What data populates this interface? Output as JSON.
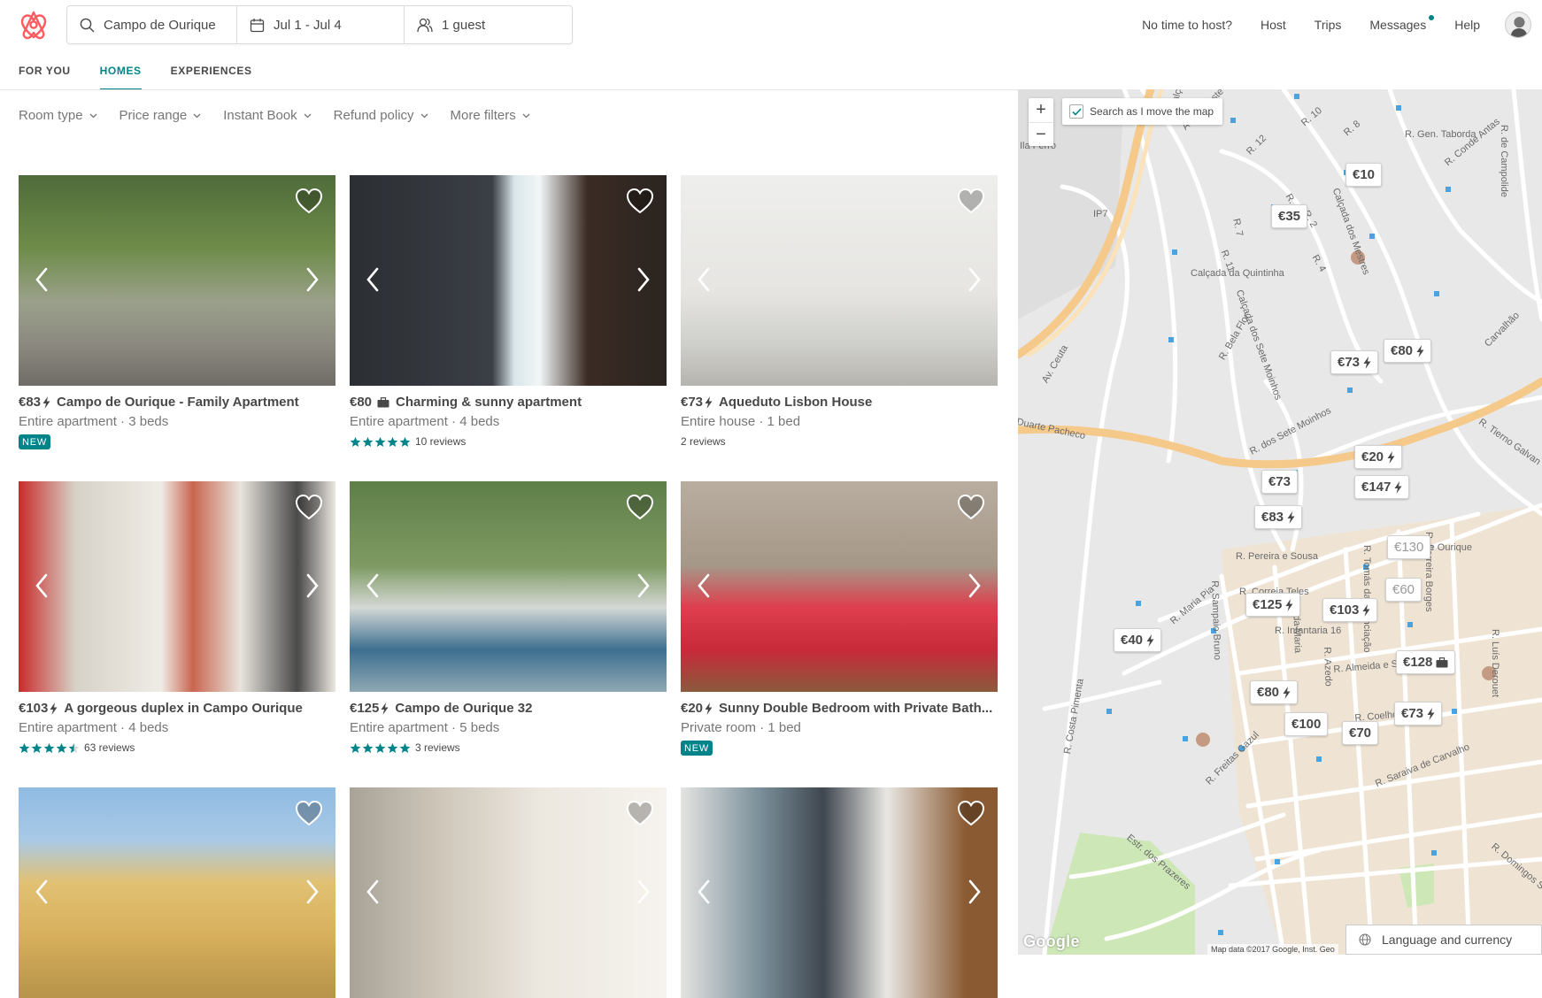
{
  "search": {
    "location": "Campo de Ourique",
    "dates": "Jul 1 - Jul 4",
    "guests": "1 guest"
  },
  "top_nav": {
    "no_time": "No time to host?",
    "host": "Host",
    "trips": "Trips",
    "messages": "Messages",
    "help": "Help"
  },
  "tabs": [
    "FOR YOU",
    "HOMES",
    "EXPERIENCES"
  ],
  "active_tab": "HOMES",
  "filters": [
    "Room type",
    "Price range",
    "Instant Book",
    "Refund policy",
    "More filters"
  ],
  "listings": [
    {
      "price": "€83",
      "badge": "instant",
      "name": "Campo de Ourique - Family Apartment",
      "subtitle": "Entire apartment · 3 beds",
      "tag": "NEW",
      "reviews": "",
      "stars": 0,
      "photo": "park"
    },
    {
      "price": "€80",
      "badge": "business",
      "name": "Charming & sunny apartment",
      "subtitle": "Entire apartment · 4 beds",
      "tag": "",
      "reviews": "10 reviews",
      "stars": 5,
      "photo": "livingroom"
    },
    {
      "price": "€73",
      "badge": "instant",
      "name": "Aqueduto Lisbon House",
      "subtitle": "Entire house · 1 bed",
      "tag": "",
      "reviews": "2 reviews",
      "stars": 0,
      "photo": "whiteroom"
    },
    {
      "price": "€103",
      "badge": "instant",
      "name": "A gorgeous duplex in Campo Ourique",
      "subtitle": "Entire apartment · 4 beds",
      "tag": "",
      "reviews": "63 reviews",
      "stars": 4.5,
      "photo": "bedroom"
    },
    {
      "price": "€125",
      "badge": "instant",
      "name": "Campo de Ourique 32",
      "subtitle": "Entire apartment · 5 beds",
      "tag": "",
      "reviews": "3 reviews",
      "stars": 5,
      "photo": "balcony"
    },
    {
      "price": "€20",
      "badge": "instant",
      "name": "Sunny Double Bedroom with Private Bath...",
      "subtitle": "Private room · 1 bed",
      "tag": "NEW",
      "reviews": "",
      "stars": 0,
      "photo": "redbed"
    },
    {
      "price": "",
      "badge": "",
      "name": "",
      "subtitle": "",
      "tag": "",
      "reviews": "",
      "stars": 0,
      "photo": "building"
    },
    {
      "price": "",
      "badge": "",
      "name": "",
      "subtitle": "",
      "tag": "",
      "reviews": "",
      "stars": 0,
      "photo": "flowers"
    },
    {
      "price": "",
      "badge": "",
      "name": "",
      "subtitle": "",
      "tag": "",
      "reviews": "",
      "stars": 0,
      "photo": "kitchen"
    }
  ],
  "map": {
    "search_as_move": "Search as I move the map",
    "search_as_move_checked": true,
    "zoom_in": "+",
    "zoom_out": "−",
    "pins": [
      {
        "label": "€10",
        "icon": "",
        "seen": false
      },
      {
        "label": "€35",
        "icon": "",
        "seen": false
      },
      {
        "label": "€73",
        "icon": "instant",
        "seen": false
      },
      {
        "label": "€80",
        "icon": "instant",
        "seen": false
      },
      {
        "label": "€20",
        "icon": "instant",
        "seen": false
      },
      {
        "label": "€73",
        "icon": "",
        "seen": false
      },
      {
        "label": "€147",
        "icon": "instant",
        "seen": false
      },
      {
        "label": "€83",
        "icon": "instant",
        "seen": false
      },
      {
        "label": "€130",
        "icon": "",
        "seen": true
      },
      {
        "label": "€60",
        "icon": "",
        "seen": true
      },
      {
        "label": "€125",
        "icon": "instant",
        "seen": false
      },
      {
        "label": "€103",
        "icon": "instant",
        "seen": false
      },
      {
        "label": "€40",
        "icon": "instant",
        "seen": false
      },
      {
        "label": "€128",
        "icon": "business",
        "seen": false
      },
      {
        "label": "€80",
        "icon": "instant",
        "seen": false
      },
      {
        "label": "€73",
        "icon": "instant",
        "seen": false
      },
      {
        "label": "€100",
        "icon": "",
        "seen": false
      },
      {
        "label": "€70",
        "icon": "",
        "seen": false
      }
    ],
    "road_labels": [
      "Calçada da Quintinha",
      "Calçada dos Sete Moinhos",
      "R. Bela Flor",
      "Av. Ceuta",
      "Duarte Pacheco",
      "R. dos Sete Moinhos",
      "R. Maria Pia",
      "R. Pereira e Sousa",
      "R. Correia Teles",
      "R. Infantaria 16",
      "R. Sampaio Bruno",
      "R. Tomás da Anunciação",
      "R. Ferreira Borges",
      "R. Almeida e Sousa",
      "R. Coelho",
      "R. Saraiva de Carvalho",
      "Estr. dos Prazeres",
      "R. Costa Pimenta",
      "R. Freitas Gazul",
      "R. Domingos Se",
      "R. Gen. Taborda",
      "R. de Campolide",
      "R. Conde Antas",
      "R. Luís Derouet",
      "R. Tierno Galvan",
      "Campo de Ourique",
      "Calçada",
      "Av. Calouste Gu",
      "R. 10",
      "R. 12",
      "R. 8",
      "R. 7",
      "R. 11",
      "R. 1",
      "R. 2",
      "R. 4",
      "Calçada dos Mestres",
      "IP7",
      "R. Azedo",
      "R. da Maria",
      "Carvalhão",
      "Ila Ferro"
    ],
    "google": "Google",
    "credits": "Map data ©2017 Google, Inst. Geo",
    "language_button": "Language and currency"
  },
  "colors": {
    "brand": "#FF5A5F",
    "accent": "#008489",
    "text": "#484848",
    "muted": "#767676"
  }
}
